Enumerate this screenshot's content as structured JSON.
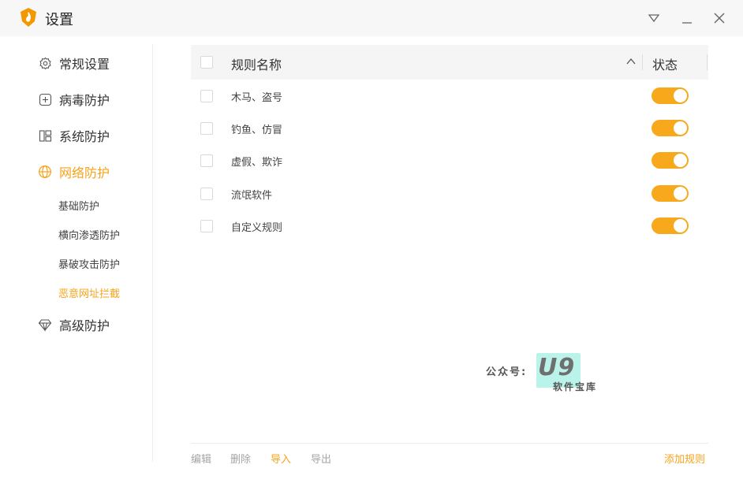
{
  "window": {
    "title": "设置",
    "controls": [
      "dropdown-icon",
      "minimize-icon",
      "close-icon"
    ]
  },
  "colors": {
    "accent": "#f5a31a",
    "toggle_on": "#f8a81b",
    "logo_orange": "#f39800"
  },
  "sidebar": {
    "items": [
      {
        "label": "常规设置",
        "icon": "gear-icon"
      },
      {
        "label": "病毒防护",
        "icon": "plus-square-icon"
      },
      {
        "label": "系统防护",
        "icon": "windows-icon"
      },
      {
        "label": "网络防护",
        "icon": "globe-icon",
        "active": true
      },
      {
        "label": "高级防护",
        "icon": "diamond-icon"
      }
    ],
    "network_sub_items": [
      {
        "label": "基础防护"
      },
      {
        "label": "横向渗透防护"
      },
      {
        "label": "暴破攻击防护"
      },
      {
        "label": "恶意网址拦截",
        "active": true
      }
    ]
  },
  "table": {
    "headers": {
      "name": "规则名称",
      "status": "状态"
    },
    "rows": [
      {
        "name": "木马、盗号",
        "enabled": true
      },
      {
        "name": "钓鱼、仿冒",
        "enabled": true
      },
      {
        "name": "虚假、欺诈",
        "enabled": true
      },
      {
        "name": "流氓软件",
        "enabled": true
      },
      {
        "name": "自定义规则",
        "enabled": true
      }
    ]
  },
  "watermark": {
    "prefix": "公众号:",
    "brand": "U9",
    "sub": "软件宝库"
  },
  "footer": {
    "edit": "编辑",
    "delete": "删除",
    "import": "导入",
    "export": "导出",
    "add_rule": "添加规则"
  }
}
